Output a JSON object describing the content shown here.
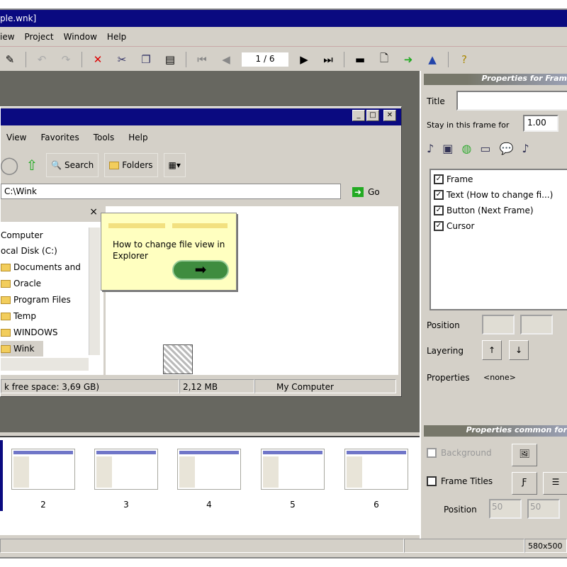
{
  "window": {
    "title": "ple.wnk]"
  },
  "menu": [
    "iew",
    "Project",
    "Window",
    "Help"
  ],
  "toolbar": {
    "frame_counter": "1 / 6"
  },
  "explorer": {
    "menu": [
      "View",
      "Favorites",
      "Tools",
      "Help"
    ],
    "buttons": {
      "search": "Search",
      "folders": "Folders"
    },
    "address": "C:\\Wink",
    "go": "Go",
    "folders_close": "×",
    "tree": [
      "Computer",
      "ocal Disk (C:)",
      "Documents and",
      "Oracle",
      "Program Files",
      "Temp",
      "WINDOWS",
      "Wink"
    ],
    "status": [
      "k free space: 3,69 GB)",
      "2,12 MB",
      "My Computer"
    ]
  },
  "tooltip": {
    "text": "How to change file view in Explorer",
    "button": "➡"
  },
  "props_frame": {
    "header": "Properties for Fram",
    "title_label": "Title",
    "title_value": "",
    "stay_label": "Stay in this frame for",
    "stay_value": "1.00",
    "objects": [
      "Frame",
      "Text (How to change fi...)",
      "Button (Next Frame)",
      "Cursor"
    ],
    "position_label": "Position",
    "layering_label": "Layering",
    "properties_label": "Properties",
    "properties_value": "<none>"
  },
  "props_common": {
    "header": "Properties common for",
    "background_label": "Background",
    "frame_titles_label": "Frame Titles",
    "position_label": "Position",
    "pos_x": "50",
    "pos_y": "50"
  },
  "filmstrip": {
    "frames": [
      "2",
      "3",
      "4",
      "5",
      "6"
    ]
  },
  "statusbar": {
    "dimensions": "580x500"
  }
}
